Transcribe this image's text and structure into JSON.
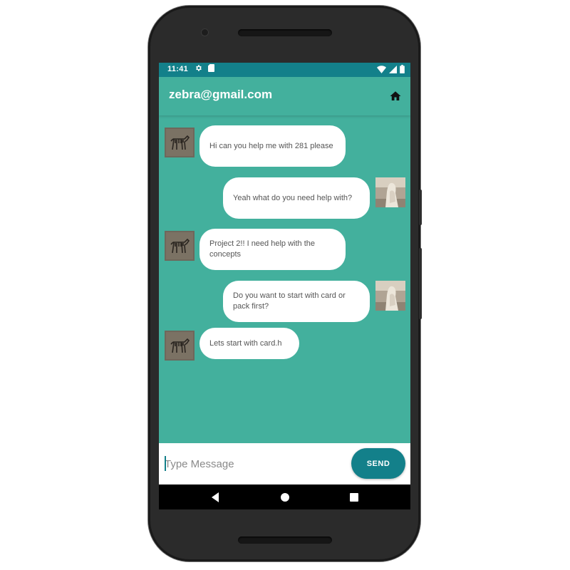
{
  "status_bar": {
    "time": "11:41",
    "icons": [
      "settings-icon",
      "sd-card-icon",
      "wifi-icon",
      "signal-icon",
      "battery-icon"
    ]
  },
  "app_bar": {
    "title": "zebra@gmail.com",
    "home_icon": "home-icon"
  },
  "conversation": {
    "messages": [
      {
        "sender": "zebra",
        "text": "Hi can you help me with 281 please"
      },
      {
        "sender": "other",
        "text": "Yeah what do you need help with?"
      },
      {
        "sender": "zebra",
        "text": "Project 2!! I need help with the concepts"
      },
      {
        "sender": "other",
        "text": "Do you want to start with card or pack first?"
      },
      {
        "sender": "zebra",
        "text": "Lets start with card.h"
      }
    ]
  },
  "composer": {
    "placeholder": "Type Message",
    "value": "",
    "send_label": "SEND"
  },
  "nav_bar": {
    "buttons": [
      "back-icon",
      "home-circle-icon",
      "recents-icon"
    ]
  },
  "colors": {
    "background": "#43b09d",
    "status_bar": "#13808a",
    "accent": "#13808a",
    "bubble": "#ffffff",
    "bubble_text": "#555555"
  }
}
